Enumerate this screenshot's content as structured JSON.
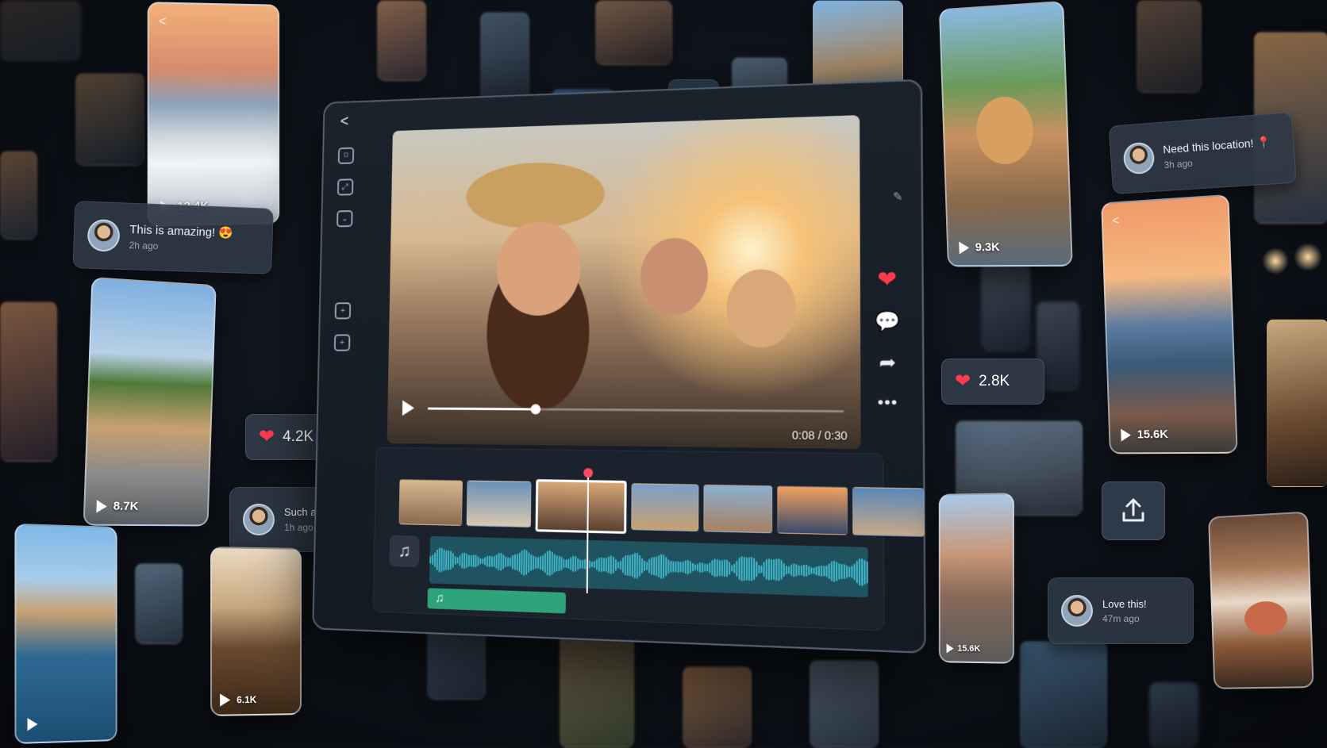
{
  "editor": {
    "back_icon": "chevron-left-icon",
    "tools": [
      "crop-icon",
      "resize-icon",
      "filter-icon",
      "add-media-icon",
      "add-clip-icon"
    ],
    "edit_icon": "edit-icon",
    "player": {
      "time": "0:08 / 0:30",
      "progress_fraction": 0.27
    },
    "actions": [
      "heart-icon",
      "comment-icon",
      "share-icon",
      "more-icon"
    ],
    "timeline": {
      "thumb_count": 7,
      "selected_index": 2,
      "music_icon": "♫",
      "clip_icon": "♫"
    }
  },
  "cards": {
    "santorini": {
      "count": "12.4K"
    },
    "skater": {
      "count": "8.7K"
    },
    "coffee": {
      "count": "6.1K"
    },
    "dog": {
      "count": "9.3K"
    },
    "sunset": {
      "count": "15.6K"
    },
    "street": {
      "count": "15.6K"
    }
  },
  "pills": {
    "left_likes": "4.2K",
    "right_likes": "2.8K"
  },
  "comments": [
    {
      "text": "This is amazing! 😍",
      "time": "2h ago"
    },
    {
      "text": "Such a vibe! ✨",
      "time": "1h ago"
    },
    {
      "text": "Need this location! 📍",
      "time": "3h ago"
    },
    {
      "text": "Love this!",
      "time": "47m ago"
    }
  ],
  "colors": {
    "heart": "#ff3b4f",
    "music_clip": "#2fa37a",
    "waveform": "#1f5360"
  }
}
